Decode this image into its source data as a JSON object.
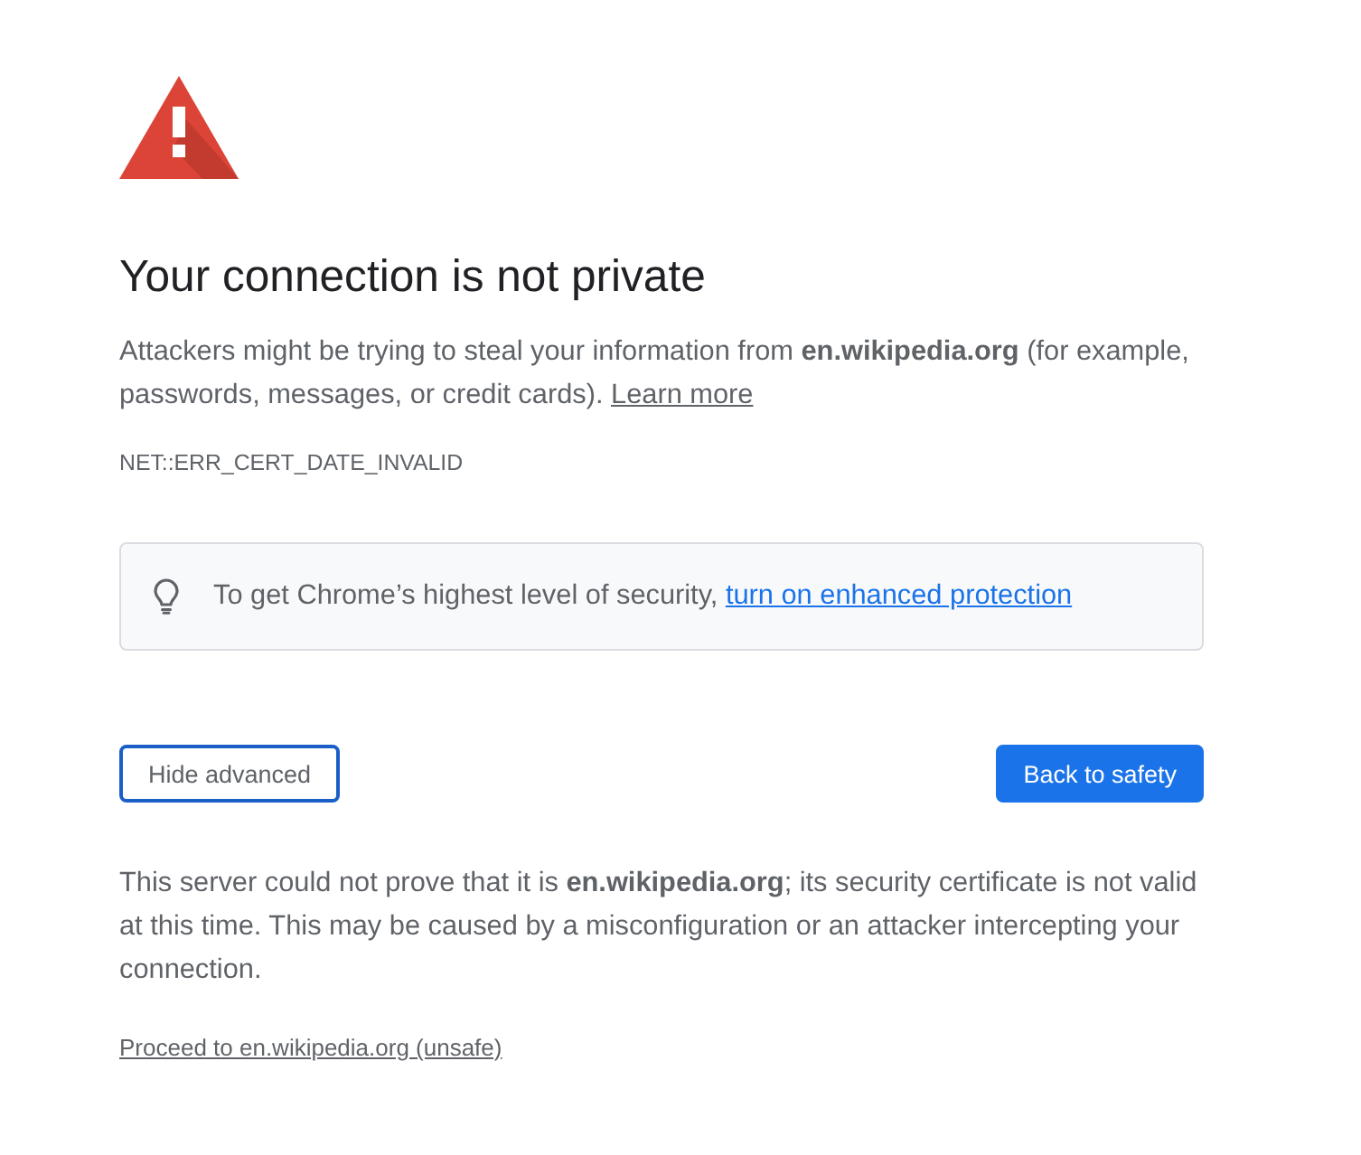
{
  "heading": "Your connection is not private",
  "intro": {
    "text": "Attackers might be trying to steal your information from **en.wikipedia.org** (for example, passwords, messages, or credit cards).",
    "link": "Learn more"
  },
  "error_code": "NET::ERR_CERT_DATE_INVALID",
  "tip": {
    "text": "To get Chrome’s highest level of security,",
    "link": "turn on enhanced protection"
  },
  "buttons": [
    {
      "kind": "secondary",
      "label": "Hide advanced"
    },
    {
      "kind": "primary",
      "label": "Back to safety"
    }
  ],
  "details": "This server could not prove that it is **en.wikipedia.org**; its security certificate is not valid at this time. This may be caused by a misconfiguration or an attacker intercepting your connection.",
  "proceed_link": "Proceed to en.wikipedia.org (unsafe)"
}
